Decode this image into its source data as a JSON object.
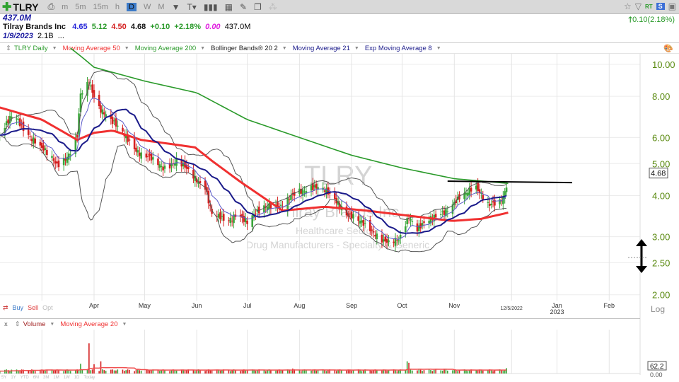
{
  "toolbar": {
    "symbol": "TLRY",
    "timeframes": [
      "m",
      "5m",
      "15m",
      "h",
      "D",
      "W",
      "M"
    ],
    "active_timeframe": "D",
    "rt_label": "RT",
    "s_label": "S"
  },
  "quote": {
    "volume_big": "437.0M",
    "company": "Tilray Brands Inc",
    "open": "4.65",
    "high": "5.12",
    "low": "4.50",
    "close": "4.68",
    "change": "+0.10",
    "change_pct": "+2.18%",
    "extra": "0.00",
    "volume": "437.0M",
    "date": "1/9/2023",
    "shares": "2.1B",
    "more": "...",
    "header_change": "0.10(2.18%)"
  },
  "indicators": [
    {
      "label": "TLRY Daily",
      "color": "#2a9a2a"
    },
    {
      "label": "Moving Average 50",
      "color": "#f03030"
    },
    {
      "label": "Moving Average 200",
      "color": "#2a9a2a"
    },
    {
      "label": "Bollinger Bands® 20 2",
      "color": "#222222"
    },
    {
      "label": "Moving Average 21",
      "color": "#1a1a8a"
    },
    {
      "label": "Exp Moving Average 8",
      "color": "#1a1a8a"
    }
  ],
  "watermark": {
    "symbol": "TLRY",
    "company": "Tilray Brands Inc",
    "sector": "Healthcare Sector",
    "industry": "Drug Manufacturers - Specialty & Generic"
  },
  "trade": {
    "buy": "Buy",
    "sell": "Sell",
    "opt": "Opt"
  },
  "volume_panel": {
    "close_label": "x",
    "volume_label": "Volume",
    "ma_label": "Moving Average 20",
    "last_value": "62.2",
    "zero": "0.00"
  },
  "timeframe_row": [
    "5Y",
    "1Y",
    "YTD",
    "6M",
    "3M",
    "1M",
    "1W",
    "1D",
    "Today"
  ],
  "colors": {
    "up": "#3aa53a",
    "down": "#d42020",
    "ma50": "#f03030",
    "ma200": "#2a9a2a",
    "ma21": "#1a1a8a",
    "ema8": "#5a5ac8",
    "bb": "#555555",
    "vol_ma": "#f05050"
  },
  "chart_data": {
    "type": "candlestick",
    "scale": "log",
    "axis_label": "Log",
    "last_price": "4.68",
    "y_ticks": [
      "10.00",
      "8.00",
      "6.00",
      "5.00",
      "4.00",
      "3.00",
      "2.50",
      "2.00"
    ],
    "x_labels": [
      {
        "label": "Apr",
        "date": "2022-04-01"
      },
      {
        "label": "May",
        "date": "2022-05-01"
      },
      {
        "label": "Jun",
        "date": "2022-06-01"
      },
      {
        "label": "Jul",
        "date": "2022-07-01"
      },
      {
        "label": "Aug",
        "date": "2022-08-01"
      },
      {
        "label": "Sep",
        "date": "2022-09-01"
      },
      {
        "label": "Oct",
        "date": "2022-10-01"
      },
      {
        "label": "Nov",
        "date": "2022-11-01"
      },
      {
        "label": "12/5/2022",
        "date": "2022-12-05"
      },
      {
        "label": "Jan",
        "sub": "2023",
        "date": "2023-01-01"
      },
      {
        "label": "Feb",
        "date": "2023-02-01"
      }
    ],
    "price_path": [
      [
        "2022-02-04",
        6.1
      ],
      [
        "2022-02-12",
        7.0
      ],
      [
        "2022-02-21",
        6.2
      ],
      [
        "2022-03-01",
        5.5
      ],
      [
        "2022-03-10",
        5.0
      ],
      [
        "2022-03-18",
        5.4
      ],
      [
        "2022-03-22",
        6.0
      ],
      [
        "2022-03-24",
        8.0
      ],
      [
        "2022-03-29",
        8.8
      ],
      [
        "2022-04-04",
        7.5
      ],
      [
        "2022-04-12",
        6.6
      ],
      [
        "2022-04-21",
        6.0
      ],
      [
        "2022-04-29",
        5.3
      ],
      [
        "2022-05-12",
        4.9
      ],
      [
        "2022-05-20",
        5.1
      ],
      [
        "2022-05-29",
        4.6
      ],
      [
        "2022-06-06",
        4.3
      ],
      [
        "2022-06-10",
        3.5
      ],
      [
        "2022-06-19",
        3.3
      ],
      [
        "2022-06-25",
        3.6
      ],
      [
        "2022-07-01",
        3.3
      ],
      [
        "2022-07-14",
        3.8
      ],
      [
        "2022-07-22",
        3.7
      ],
      [
        "2022-07-31",
        4.1
      ],
      [
        "2022-08-08",
        4.3
      ],
      [
        "2022-08-16",
        4.1
      ],
      [
        "2022-08-25",
        3.8
      ],
      [
        "2022-08-29",
        3.55
      ],
      [
        "2022-09-06",
        3.3
      ],
      [
        "2022-09-15",
        3.1
      ],
      [
        "2022-09-23",
        2.85
      ],
      [
        "2022-09-29",
        2.9
      ],
      [
        "2022-10-05",
        3.5
      ],
      [
        "2022-10-10",
        3.2
      ],
      [
        "2022-10-16",
        3.3
      ],
      [
        "2022-10-23",
        3.5
      ],
      [
        "2022-10-31",
        3.8
      ],
      [
        "2022-11-08",
        4.0
      ],
      [
        "2022-11-13",
        4.3
      ],
      [
        "2022-11-17",
        4.1
      ],
      [
        "2022-11-21",
        3.8
      ],
      [
        "2022-11-27",
        3.7
      ],
      [
        "2022-11-30",
        3.9
      ],
      [
        "2022-12-04",
        4.68
      ]
    ],
    "ma200": [
      [
        "2022-03-18",
        11.2
      ],
      [
        "2022-03-25",
        10.5
      ],
      [
        "2022-04-01",
        9.8
      ],
      [
        "2022-05-01",
        8.9
      ],
      [
        "2022-06-01",
        8.2
      ],
      [
        "2022-07-01",
        6.8
      ],
      [
        "2022-08-01",
        6.0
      ],
      [
        "2022-09-01",
        5.3
      ],
      [
        "2022-10-01",
        4.85
      ],
      [
        "2022-11-01",
        4.5
      ],
      [
        "2022-12-04",
        4.35
      ]
    ],
    "ma50": [
      [
        "2022-02-04",
        7.4
      ],
      [
        "2022-03-01",
        6.8
      ],
      [
        "2022-03-22",
        5.9
      ],
      [
        "2022-04-01",
        6.2
      ],
      [
        "2022-04-12",
        6.3
      ],
      [
        "2022-04-29",
        5.9
      ],
      [
        "2022-05-15",
        5.75
      ],
      [
        "2022-05-31",
        5.6
      ],
      [
        "2022-06-10",
        5.1
      ],
      [
        "2022-06-27",
        4.4
      ],
      [
        "2022-07-22",
        3.6
      ],
      [
        "2022-08-16",
        3.7
      ],
      [
        "2022-09-10",
        3.6
      ],
      [
        "2022-10-06",
        3.47
      ],
      [
        "2022-10-31",
        3.35
      ],
      [
        "2022-11-17",
        3.4
      ],
      [
        "2022-12-03",
        3.55
      ]
    ],
    "trendline": {
      "price": 4.4,
      "from": "2022-10-28",
      "to": "2023-01-10"
    },
    "volume_base": 35,
    "volume_spikes": [
      [
        "2022-03-24",
        100
      ],
      [
        "2022-03-29",
        310
      ],
      [
        "2022-04-01",
        95
      ],
      [
        "2022-04-05",
        125
      ],
      [
        "2022-07-28",
        50
      ],
      [
        "2022-10-04",
        125
      ],
      [
        "2022-10-05",
        110
      ],
      [
        "2022-12-02",
        55
      ],
      [
        "2022-12-04",
        62.2
      ]
    ],
    "volume_max": 450
  }
}
